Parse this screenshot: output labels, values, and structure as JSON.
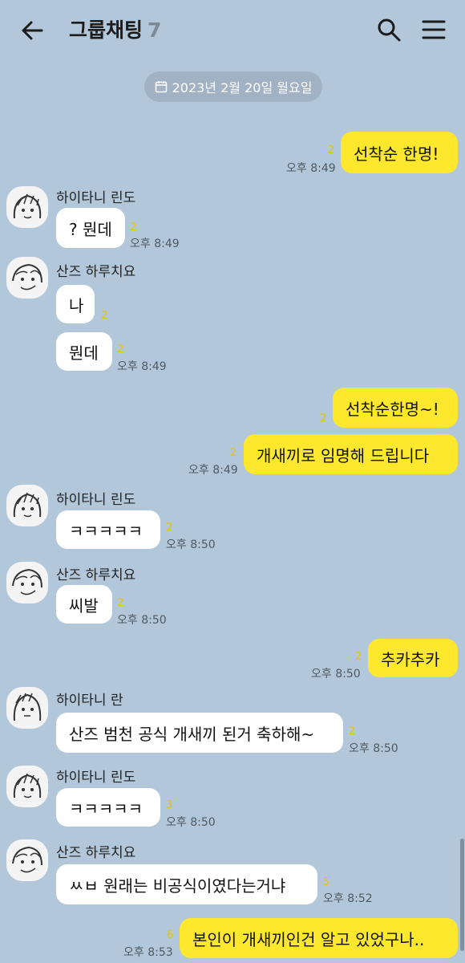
{
  "header": {
    "title": "그룹채팅",
    "member_count": "7",
    "icons": [
      "arrow-left-icon",
      "search-icon",
      "hamburger-menu-icon"
    ]
  },
  "date_divider": "2023년 2월 20일 월요일",
  "colors": {
    "background": "#b2c7da",
    "my_bubble": "#fde82e",
    "other_bubble": "#ffffff",
    "unread": "#e8c500"
  },
  "messages": [
    {
      "text": "선착순 한명!",
      "unread": "2",
      "time": "오후 8:49"
    },
    {
      "sender": "하이타니 린도",
      "text": "? 뭔데",
      "unread": "2",
      "time": "오후 8:49"
    },
    {
      "sender": "산즈 하루치요",
      "text": "나",
      "unread": "2"
    },
    {
      "text": "뭔데",
      "unread": "2",
      "time": "오후 8:49"
    },
    {
      "text": "선착순한명~!",
      "unread": "2"
    },
    {
      "text": "개새끼로 임명해 드립니다",
      "unread": "2",
      "time": "오후 8:49"
    },
    {
      "sender": "하이타니 린도",
      "text": "ㅋㅋㅋㅋㅋ",
      "unread": "2",
      "time": "오후 8:50"
    },
    {
      "sender": "산즈 하루치요",
      "text": "씨발",
      "unread": "2",
      "time": "오후 8:50"
    },
    {
      "text": "추카추카",
      "unread": "2",
      "time": "오후 8:50"
    },
    {
      "sender": "하이타니 란",
      "text": "산즈 범천 공식 개새끼 된거 축하해~",
      "unread": "2",
      "time": "오후 8:50"
    },
    {
      "sender": "하이타니 린도",
      "text": "ㅋㅋㅋㅋㅋ",
      "unread": "3",
      "time": "오후 8:50"
    },
    {
      "sender": "산즈 하루치요",
      "text": "ㅆㅂ 원래는 비공식이였다는거냐",
      "unread": "5",
      "time": "오후 8:52"
    },
    {
      "text": "본인이 개새끼인건 알고 있었구나..",
      "unread": "6",
      "time": "오후 8:53"
    }
  ]
}
